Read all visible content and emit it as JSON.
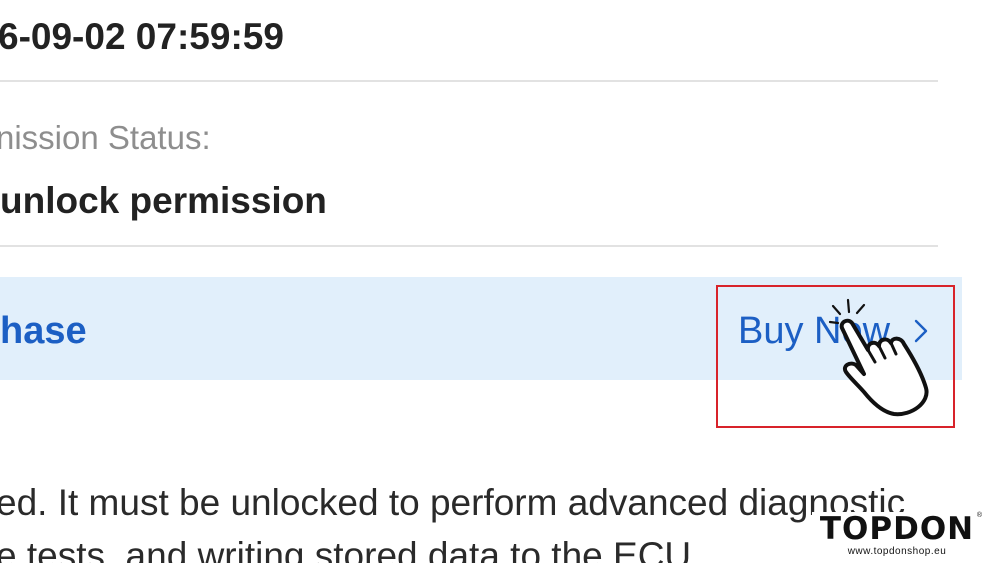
{
  "header": {
    "datetime": "6-09-02 07:59:59"
  },
  "permission": {
    "label": "nission Status:",
    "value": "unlock permission"
  },
  "purchase": {
    "label": "hase",
    "buy_now_label": "Buy Now"
  },
  "description": {
    "line1": "ed. It must be unlocked to perform advanced diagnostic",
    "line2": "e tests, and writing stored data to the ECU."
  },
  "watermark": {
    "brand": "TOPDON",
    "url": "www.topdonshop.eu",
    "reg_mark": "®"
  },
  "colors": {
    "accent": "#1c5fc4",
    "banner_background": "#e1effb",
    "highlight_border": "#d8232a"
  },
  "icons": {
    "chevron": "chevron-right-icon",
    "pointer": "hand-pointer-icon"
  }
}
